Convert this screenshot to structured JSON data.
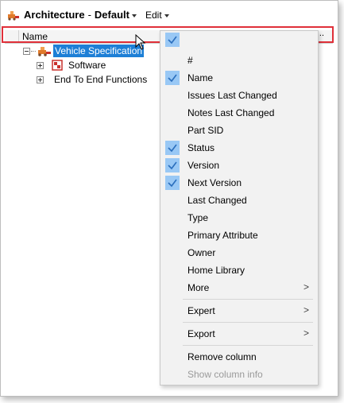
{
  "titlebar": {
    "app_name": "Architecture",
    "separator": "-",
    "view_name": "Default",
    "edit_label": "Edit"
  },
  "header": {
    "name_label": "Name",
    "more_label": "..."
  },
  "tree": {
    "root_label": "Vehicle Specification",
    "child_software": "Software",
    "child_e2e": "End To End Functions"
  },
  "menu": {
    "items": [
      {
        "label": "#",
        "checked": false
      },
      {
        "label": "Name",
        "checked": true
      },
      {
        "label": "Issues Last Changed",
        "checked": false
      },
      {
        "label": "Notes Last Changed",
        "checked": false
      },
      {
        "label": "Part SID",
        "checked": false
      },
      {
        "label": "Status",
        "checked": true
      },
      {
        "label": "Version",
        "checked": true
      },
      {
        "label": "Next Version",
        "checked": true
      },
      {
        "label": "Last Changed",
        "checked": false
      },
      {
        "label": "Type",
        "checked": false
      },
      {
        "label": "Primary Attribute",
        "checked": false
      },
      {
        "label": "Owner",
        "checked": false
      },
      {
        "label": "Home Library",
        "checked": false
      },
      {
        "label": "More",
        "submenu": true
      },
      {
        "label": "Expert",
        "submenu": true
      },
      {
        "label": "Export",
        "submenu": true
      },
      {
        "label": "Remove column"
      },
      {
        "label": "Show column info",
        "disabled": true
      }
    ],
    "submenu_arrow": ">"
  },
  "colors": {
    "selection": "#1d7fd6",
    "check_bg": "#99c8f5",
    "check_mark": "#2a6ebd",
    "highlight_border": "#e0303a"
  }
}
